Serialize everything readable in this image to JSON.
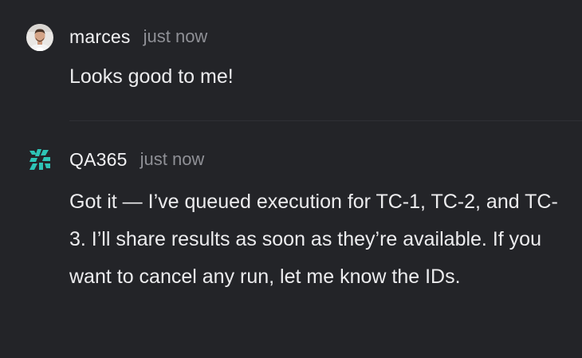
{
  "messages": [
    {
      "author": "marces",
      "timestamp": "just now",
      "text": "Looks good to me!",
      "avatar_icon": "user-photo-avatar"
    },
    {
      "author": "QA365",
      "timestamp": "just now",
      "text": "Got it — I’ve queued execution for TC-1, TC-2, and TC-3. I’ll share results as soon as they’re available. If you want to cancel any run, let me know the IDs.",
      "avatar_icon": "qa365-logo-icon"
    }
  ],
  "colors": {
    "background": "#232428",
    "text": "#ececee",
    "muted": "#8f9096",
    "bot_logo": "#2ec4b6"
  }
}
